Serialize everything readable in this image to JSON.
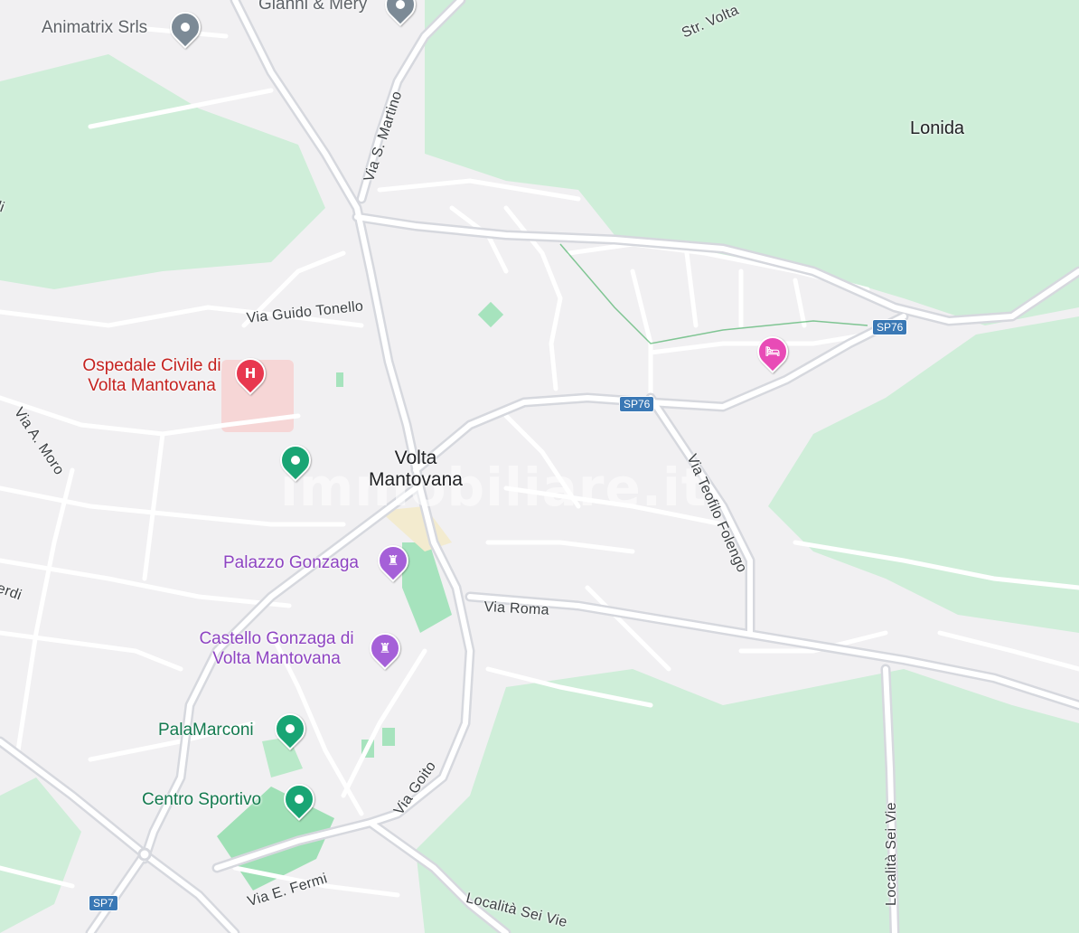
{
  "map": {
    "colors": {
      "land": "#f1f0f2",
      "green": "#cfeed9",
      "road": "#ffffff",
      "major_road": "#d6d8de",
      "hospital_area": "#f6d6d6",
      "sports_field": "#9fe0b6",
      "shield": "#3a78b5"
    },
    "place_labels": {
      "town_line1": "Volta",
      "town_line2": "Mantovana",
      "lonida": "Lonida"
    },
    "street_labels": {
      "str_volta": "Str. Volta",
      "via_s_martino": "Via S. Martino",
      "via_guido_tonello": "Via Guido Tonello",
      "via_a_moro": "Via A. Moro",
      "verdi_partial": "erdi",
      "left_partial": "li",
      "via_teofilo_folengo": "Via Teofilo Folengo",
      "via_roma": "Via Roma",
      "via_goito": "Via Goito",
      "via_e_fermi": "Via E. Fermi",
      "localita_sei_vie_vertical": "Località Sei Vie",
      "localita_sei_vie_bottom": "Località Sei Vie"
    },
    "road_shields": {
      "sp76_east": "SP76",
      "sp76_center": "SP76",
      "sp7": "SP7"
    },
    "pois": {
      "animatrix": {
        "name": "Animatrix Srls",
        "icon": "grey-pin-icon"
      },
      "gianni_mery": {
        "name": "Gianni & Mery",
        "icon": "grey-pin-icon"
      },
      "hospital": {
        "line1": "Ospedale Civile di",
        "line2": "Volta Mantovana",
        "icon": "hospital-icon",
        "glyph": "H"
      },
      "palazzo_gonzaga": {
        "name": "Palazzo Gonzaga",
        "icon": "castle-icon",
        "glyph": "♜"
      },
      "castello": {
        "line1": "Castello Gonzaga di",
        "line2": "Volta Mantovana",
        "icon": "castle-icon",
        "glyph": "♜"
      },
      "palamarconi": {
        "name": "PalaMarconi",
        "icon": "green-pin-icon"
      },
      "centro_sportivo": {
        "name": "Centro Sportivo",
        "icon": "green-pin-icon"
      },
      "park_pin": {
        "icon": "green-pin-icon"
      },
      "hotel": {
        "icon": "hotel-icon",
        "glyph": "🛏"
      }
    },
    "watermark": "immobiliare.it"
  }
}
